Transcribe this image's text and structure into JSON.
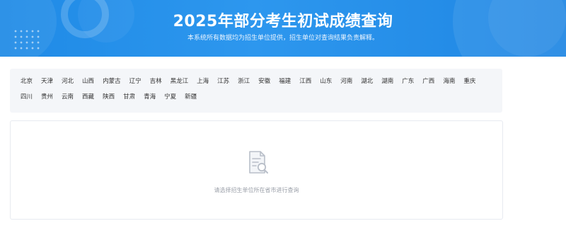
{
  "banner": {
    "title": "2025年部分考生初试成绩查询",
    "subtitle": "本系统所有数据均为招生单位提供，招生单位对查询结果负责解释。"
  },
  "regions": [
    "北京",
    "天津",
    "河北",
    "山西",
    "内蒙古",
    "辽宁",
    "吉林",
    "黑龙江",
    "上海",
    "江苏",
    "浙江",
    "安徽",
    "福建",
    "江西",
    "山东",
    "河南",
    "湖北",
    "湖南",
    "广东",
    "广西",
    "海南",
    "重庆",
    "四川",
    "贵州",
    "云南",
    "西藏",
    "陕西",
    "甘肃",
    "青海",
    "宁夏",
    "新疆"
  ],
  "result": {
    "empty_message": "请选择招生单位所在省市进行查询",
    "empty_icon": "document-search-icon"
  },
  "colors": {
    "banner_primary": "#2d97ee",
    "panel_bg": "#f4f6f9",
    "text": "#333333",
    "muted_text": "#9a9fa8"
  }
}
